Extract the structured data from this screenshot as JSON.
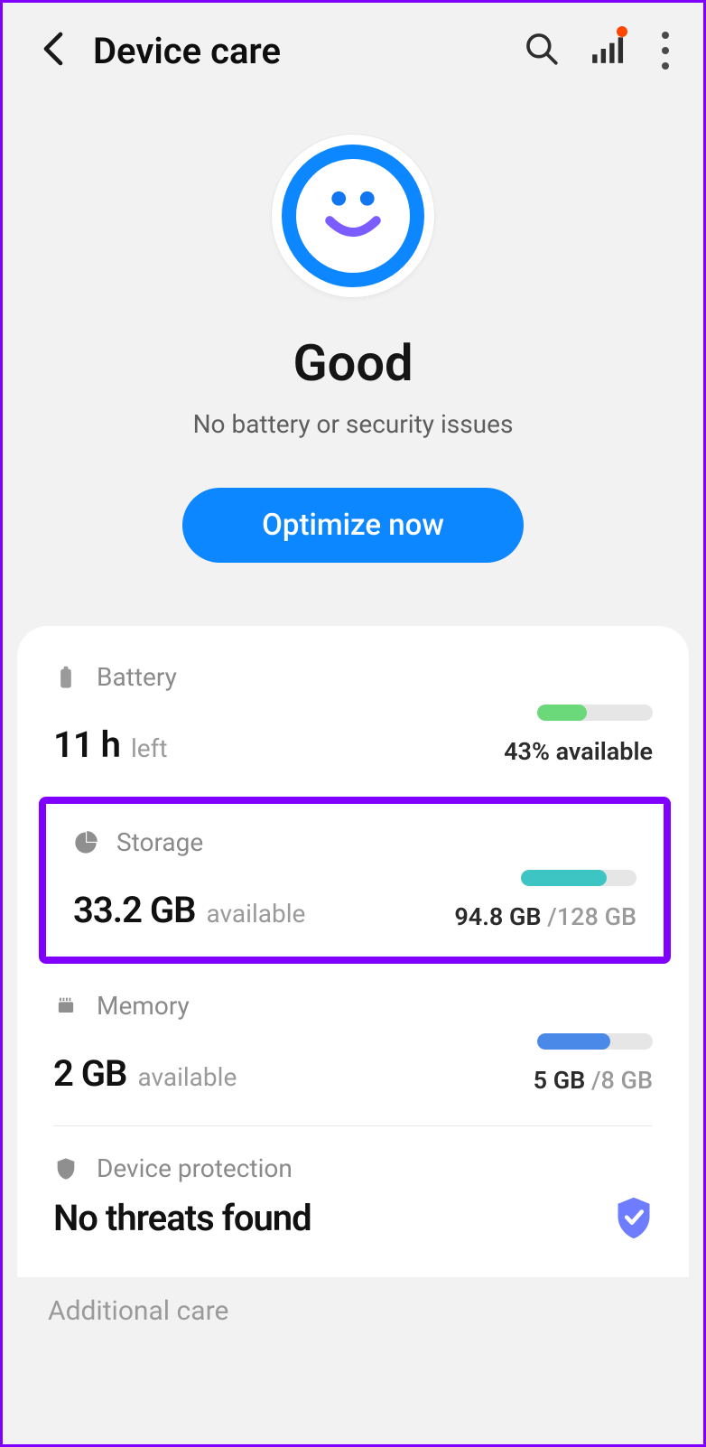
{
  "header": {
    "title": "Device care"
  },
  "status": {
    "title": "Good",
    "subtitle": "No battery or security issues",
    "button": "Optimize now"
  },
  "battery": {
    "label": "Battery",
    "value": "11 h",
    "suffix": "left",
    "right": "43% available"
  },
  "storage": {
    "label": "Storage",
    "value": "33.2 GB",
    "suffix": "available",
    "used": "94.8 GB",
    "total": "/128 GB"
  },
  "memory": {
    "label": "Memory",
    "value": "2 GB",
    "suffix": "available",
    "used": "5 GB",
    "total": "/8 GB"
  },
  "protection": {
    "label": "Device protection",
    "status": "No threats found"
  },
  "additional": "Additional care"
}
